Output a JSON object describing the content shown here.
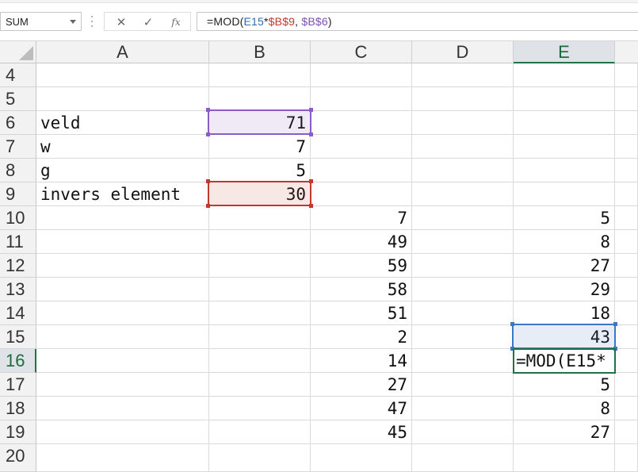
{
  "name_box": {
    "value": "SUM"
  },
  "formula_bar": {
    "cancel_glyph": "✕",
    "enter_glyph": "✓",
    "function_glyph": "fx",
    "formula": {
      "p1": "=MOD(",
      "p2": "E15",
      "p3": "*",
      "p4": "$B$9",
      "p5": ", ",
      "p6": "$B$6",
      "p7": ")"
    },
    "ref_colors": {
      "E15": "#2e6db4",
      "$B$9": "#c0392b",
      "$B$6": "#7b4fb3"
    }
  },
  "columns": [
    "A",
    "B",
    "C",
    "D",
    "E"
  ],
  "active_column": "E",
  "rows": [
    "4",
    "5",
    "6",
    "7",
    "8",
    "9",
    "10",
    "11",
    "12",
    "13",
    "14",
    "15",
    "16",
    "17",
    "18",
    "19",
    "20"
  ],
  "active_row": "16",
  "cells": {
    "A6": "veld",
    "A7": "w",
    "A8": "g",
    "A9": "invers element",
    "B6": "71",
    "B7": "7",
    "B8": "5",
    "B9": "30",
    "C10": "7",
    "C11": "49",
    "C12": "59",
    "C13": "58",
    "C14": "51",
    "C15": "2",
    "C16": "14",
    "C17": "27",
    "C18": "47",
    "C19": "45",
    "E10": "5",
    "E11": "8",
    "E12": "27",
    "E13": "29",
    "E14": "18",
    "E15": "43",
    "E16": "=MOD(E15*",
    "E17": "5",
    "E18": "8",
    "E19": "27"
  },
  "highlight_colors": {
    "B6": "#8a5cc4",
    "B9": "#c0392b",
    "E15": "#3b78c3",
    "active": "#217346"
  }
}
